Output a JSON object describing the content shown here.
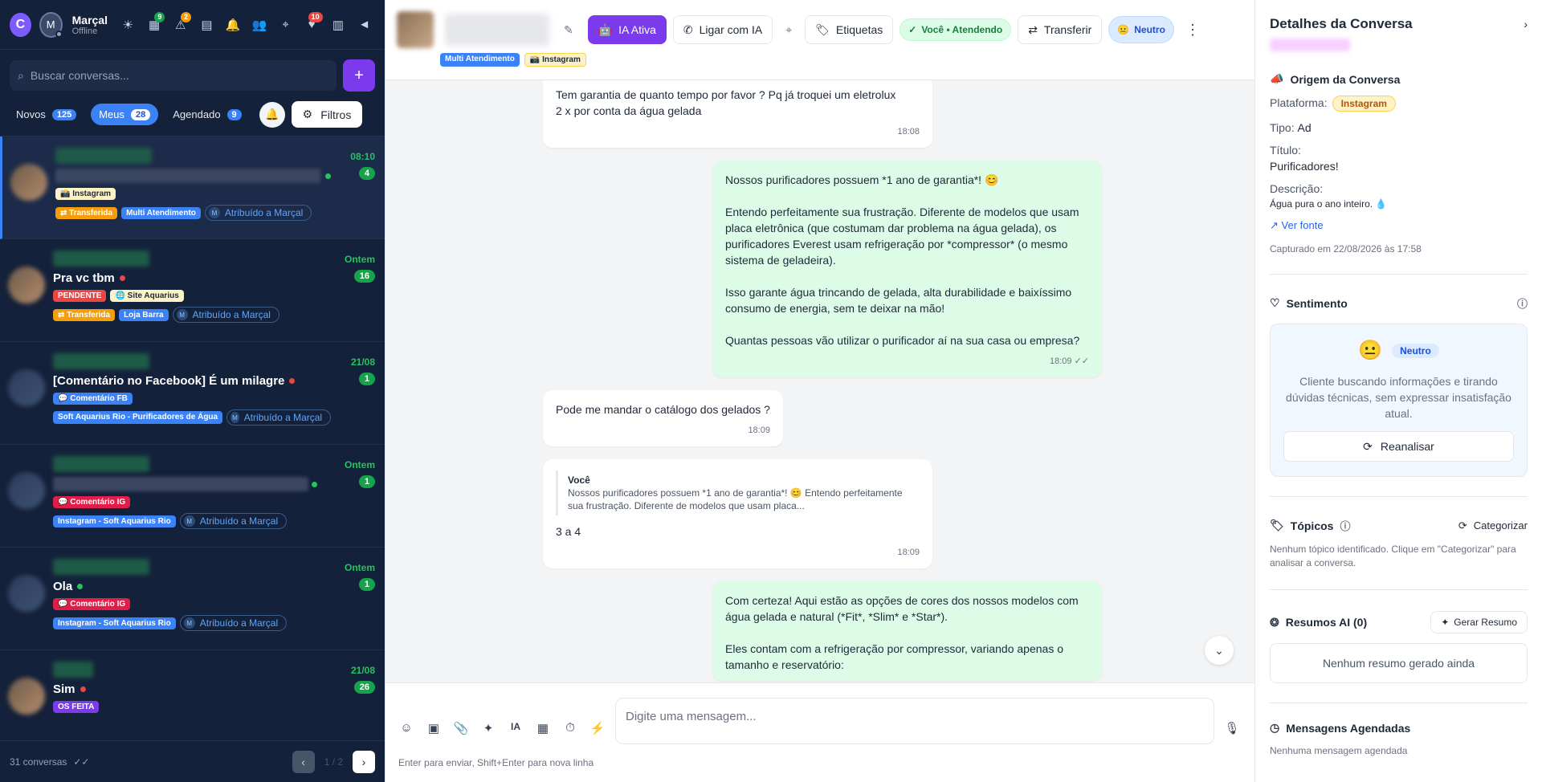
{
  "topbar": {
    "logo": "C",
    "avatar_initial": "M",
    "user_name": "Marçal",
    "user_status": "Offline",
    "icons": [
      {
        "name": "sun-icon",
        "glyph": "☀",
        "badge": null
      },
      {
        "name": "calendar-check-icon",
        "glyph": "▦",
        "badge": "9",
        "badge_color": "#16a34a"
      },
      {
        "name": "warning-icon",
        "glyph": "⚠",
        "badge": "2",
        "badge_color": "#f59e0b"
      },
      {
        "name": "document-icon",
        "glyph": "▤",
        "badge": null
      },
      {
        "name": "bell-icon",
        "glyph": "🔔",
        "badge": null
      },
      {
        "name": "users-icon",
        "glyph": "👥",
        "badge": null
      },
      {
        "name": "map-pin-icon",
        "glyph": "⌖",
        "badge": null
      },
      {
        "name": "tag-heart-icon",
        "glyph": "♥",
        "badge": "10",
        "badge_color": "#ef4444"
      },
      {
        "name": "chart-icon",
        "glyph": "▥",
        "badge": null
      },
      {
        "name": "megaphone-icon",
        "glyph": "◄",
        "badge": null
      }
    ]
  },
  "search": {
    "placeholder": "Buscar conversas..."
  },
  "filters": {
    "tabs": [
      {
        "label": "Novos",
        "count": "125"
      },
      {
        "label": "Meus",
        "count": "28"
      },
      {
        "label": "Agendado",
        "count": "9"
      }
    ],
    "filtros_label": "Filtros"
  },
  "conversations": [
    {
      "title": "",
      "time": "08:10",
      "count": "4"
    },
    {
      "title": "Pra vc tbm",
      "time": "Ontem",
      "count": "16"
    },
    {
      "title": "[Comentário no Facebook] É um milagre",
      "time": "21/08",
      "count": "1"
    },
    {
      "title": "",
      "time": "Ontem",
      "count": "1"
    },
    {
      "title": "Ola",
      "time": "Ontem",
      "count": "1"
    },
    {
      "title": "Sim",
      "time": "21/08",
      "count": "26"
    }
  ],
  "tag_labels": {
    "instagram": "📸 Instagram",
    "transferida": "⇄ Transferida",
    "multi": "Multi Atendimento",
    "assigned": "Atribuído a Marçal",
    "pendente": "PENDENTE",
    "site": "🌐 Site Aquarius",
    "loja": "Loja Barra",
    "coment_fb": "💬 Comentário FB",
    "soft_rio": "Soft Aquarius Rio - Purificadores de Água",
    "coment_ig": "💬 Comentário IG",
    "insta_soft": "Instagram - Soft Aquarius Rio",
    "os_feita": "OS FEITA",
    "assigned_initial": "M"
  },
  "footer": {
    "count_label": "31 conversas",
    "page": "1 / 2"
  },
  "chat_header": {
    "ia_label": "IA Ativa",
    "call_label": "Ligar com IA",
    "tags_label": "Etiquetas",
    "status_label": "Você • Atendendo",
    "transfer_label": "Transferir",
    "sentiment_label": "Neutro",
    "tag1": "Multi Atendimento",
    "tag2": "📸 Instagram"
  },
  "messages": {
    "m1_text": "Tem garantia de quanto tempo por favor ? Pq já troquei um eletrolux\n2 x por conta da água gelada",
    "m1_time": "18:08",
    "m2_p1": "Nossos purificadores possuem *1 ano de garantia*! 😊",
    "m2_p2": "Entendo perfeitamente sua frustração. Diferente de modelos que usam placa eletrônica (que costumam dar problema na água gelada), os purificadores Everest usam refrigeração por *compressor* (o mesmo sistema de geladeira).",
    "m2_p3": "Isso garante água trincando de gelada, alta durabilidade e baixíssimo consumo de energia, sem te deixar na mão!",
    "m2_p4": "Quantas pessoas vão utilizar o purificador aí na sua casa ou empresa?",
    "m2_time": "18:09",
    "m3_text": "Pode me mandar o catálogo dos gelados ?",
    "m3_time": "18:09",
    "m4_quote_author": "Você",
    "m4_quote_text": "Nossos purificadores possuem *1 ano de garantia*! 😊 Entendo perfeitamente sua frustração. Diferente de modelos que usam placa...",
    "m4_text": "3 a 4",
    "m4_time": "18:09",
    "m5_p1": "Com certeza! Aqui estão as opções de cores dos nossos modelos com água gelada e natural (*Fit*, *Slim* e *Star*).",
    "m5_p2": "Eles contam com a refrigeração por compressor, variando apenas o tamanho e reservatório:"
  },
  "composer": {
    "placeholder": "Digite uma mensagem...",
    "hint": "Enter para enviar, Shift+Enter para nova linha",
    "ia_label": "IA"
  },
  "details": {
    "title": "Detalhes da Conversa",
    "origem_title": "Origem da Conversa",
    "plataforma_label": "Plataforma:",
    "plataforma_value": "Instagram",
    "tipo_label": "Tipo:",
    "tipo_value": "Ad",
    "titulo_label": "Título:",
    "titulo_value": "Purificadores!",
    "descricao_label": "Descrição:",
    "descricao_value": "Água pura o ano inteiro. 💧",
    "ver_fonte": "Ver fonte",
    "captured": "Capturado em 22/08/2026 às 17:58",
    "sentimento_title": "Sentimento",
    "sentimento_badge": "Neutro",
    "sentimento_text": "Cliente buscando informações e tirando dúvidas técnicas, sem expressar insatisfação atual.",
    "reanalisar": "Reanalisar",
    "topicos_title": "Tópicos",
    "categorizar": "Categorizar",
    "topicos_empty": "Nenhum tópico identificado. Clique em \"Categorizar\" para analisar a conversa.",
    "resumos_title": "Resumos AI (0)",
    "gerar_resumo": "Gerar Resumo",
    "resumos_empty": "Nenhum resumo gerado ainda",
    "agendadas_title": "Mensagens Agendadas",
    "agendadas_empty": "Nenhuma mensagem agendada"
  }
}
